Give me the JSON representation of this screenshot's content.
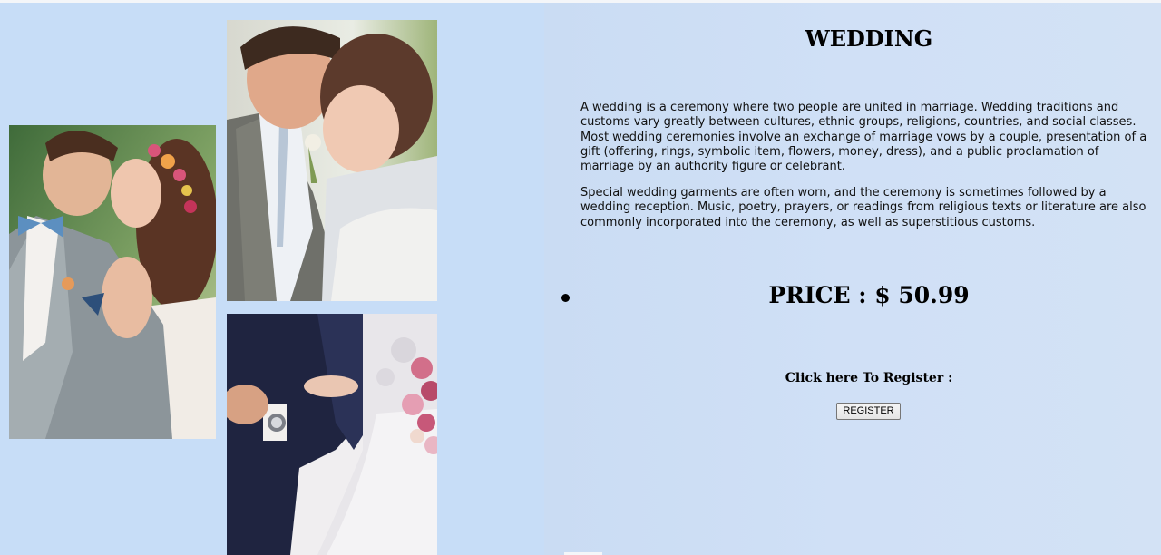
{
  "product": {
    "title": "WEDDING",
    "description": [
      "A wedding is a ceremony where two people are united in marriage. Wedding traditions and customs vary greatly between cultures, ethnic groups, religions, countries, and social classes. Most wedding ceremonies involve an exchange of marriage vows by a couple, presentation of a gift (offering, rings, symbolic item, flowers, money, dress), and a public proclamation of marriage by an authority figure or celebrant.",
      "Special wedding garments are often worn, and the ceremony is sometimes followed by a wedding reception. Music, poetry, prayers, or readings from religious texts or literature are also commonly incorporated into the ceremony, as well as superstitious customs."
    ],
    "price_text": "PRICE : $ 50.99",
    "register_prompt": "Click here To Register :",
    "register_button": "REGISTER"
  },
  "colors": {
    "page_background": "#c9dcf3",
    "text": "#000000"
  }
}
